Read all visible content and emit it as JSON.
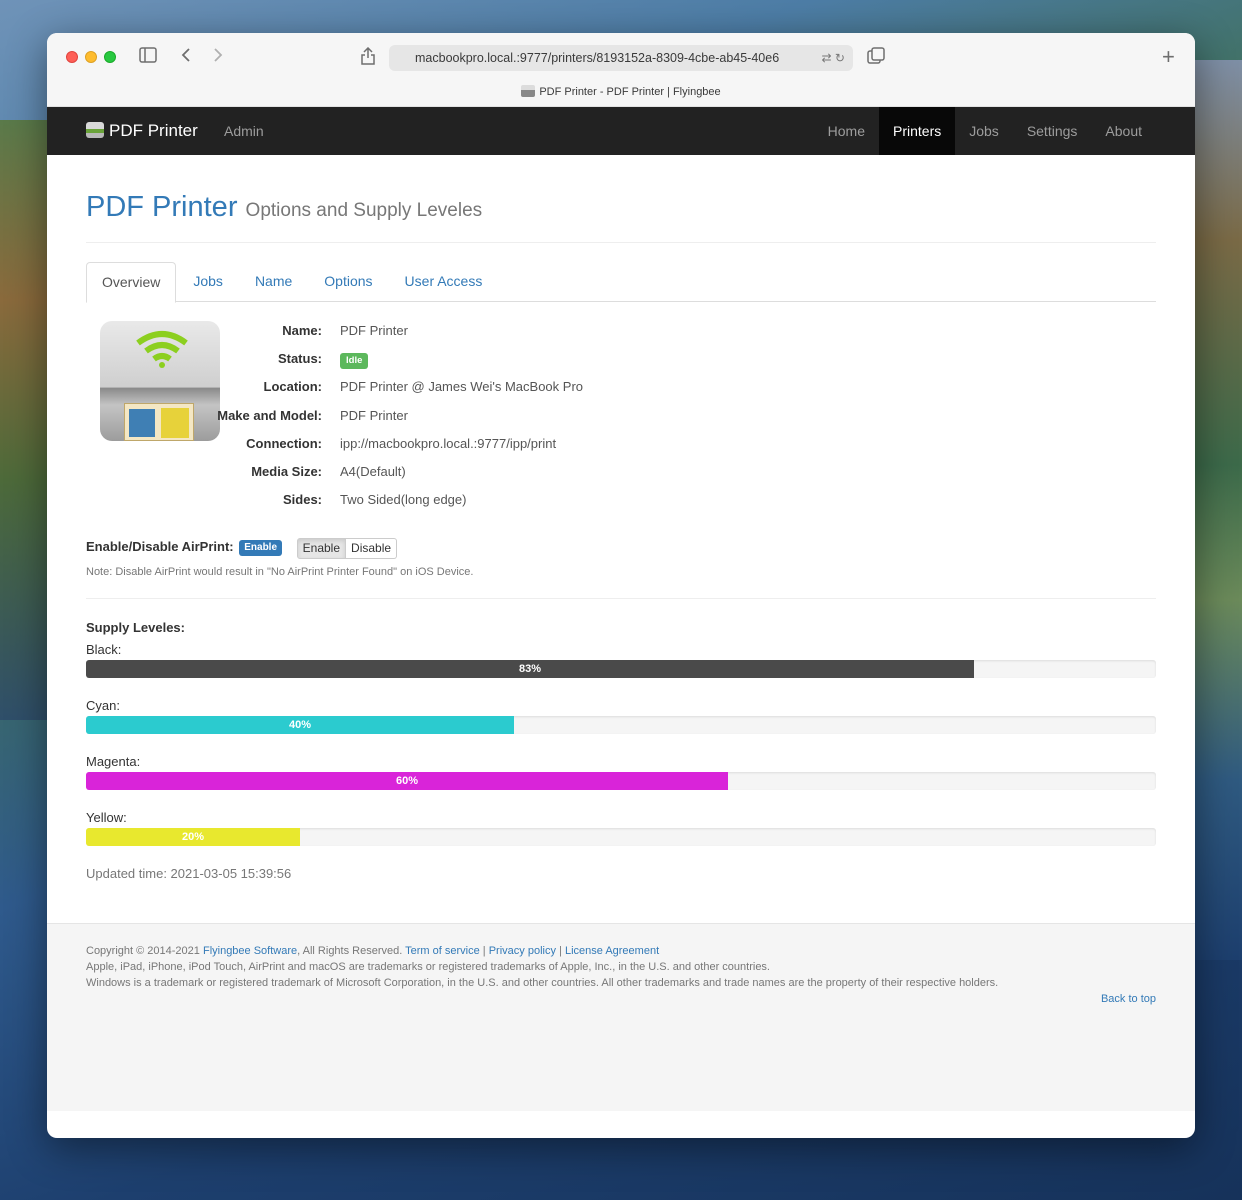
{
  "browser": {
    "url": "macbookpro.local.:9777/printers/8193152a-8309-4cbe-ab45-40e6",
    "tab_title": "PDF Printer - PDF Printer | Flyingbee"
  },
  "navbar": {
    "brand": "PDF Printer",
    "admin": "Admin",
    "links": [
      "Home",
      "Printers",
      "Jobs",
      "Settings",
      "About"
    ],
    "active": "Printers"
  },
  "header": {
    "title": "PDF Printer",
    "subtitle": "Options and Supply Leveles"
  },
  "tabs": [
    "Overview",
    "Jobs",
    "Name",
    "Options",
    "User Access"
  ],
  "info": [
    {
      "label": "Name:",
      "value": "PDF Printer"
    },
    {
      "label": "Status:",
      "value": "Idle"
    },
    {
      "label": "Location:",
      "value": "PDF Printer @ James Wei's MacBook Pro"
    },
    {
      "label": "Make and Model:",
      "value": "PDF Printer"
    },
    {
      "label": "Connection:",
      "value": "ipp://macbookpro.local.:9777/ipp/print"
    },
    {
      "label": "Media Size:",
      "value": "A4(Default)"
    },
    {
      "label": "Sides:",
      "value": "Two Sided(long edge)"
    }
  ],
  "airprint": {
    "label": "Enable/Disable AirPrint:",
    "state_badge": "Enable",
    "enable_button": "Enable",
    "disable_button": "Disable",
    "note": "Note: Disable AirPrint would result in \"No AirPrint Printer Found\" on iOS Device."
  },
  "supply": {
    "title": "Supply Leveles:",
    "levels": [
      {
        "label": "Black:",
        "percent": 83,
        "text": "83%",
        "color": "#4a4a4a"
      },
      {
        "label": "Cyan:",
        "percent": 40,
        "text": "40%",
        "color": "#2bcbcf"
      },
      {
        "label": "Magenta:",
        "percent": 60,
        "text": "60%",
        "color": "#d924d9"
      },
      {
        "label": "Yellow:",
        "percent": 20,
        "text": "20%",
        "color": "#e8e82e"
      }
    ],
    "updated": "Updated time: 2021-03-05 15:39:56"
  },
  "footer": {
    "copyright_prefix": "Copyright © 2014-2021",
    "company_link": "Flyingbee Software",
    "rights": ", All Rights Reserved.",
    "tos": "Term of service",
    "privacy": "Privacy policy",
    "license": "License Agreement",
    "line2": "Apple, iPad, iPhone, iPod Touch, AirPrint and macOS are trademarks or registered trademarks of Apple, Inc., in the U.S. and other countries.",
    "line3": "Windows is a trademark or registered trademark of Microsoft Corporation, in the U.S. and other countries. All other trademarks and trade names are the property of their respective holders.",
    "back_to_top": "Back to top"
  }
}
